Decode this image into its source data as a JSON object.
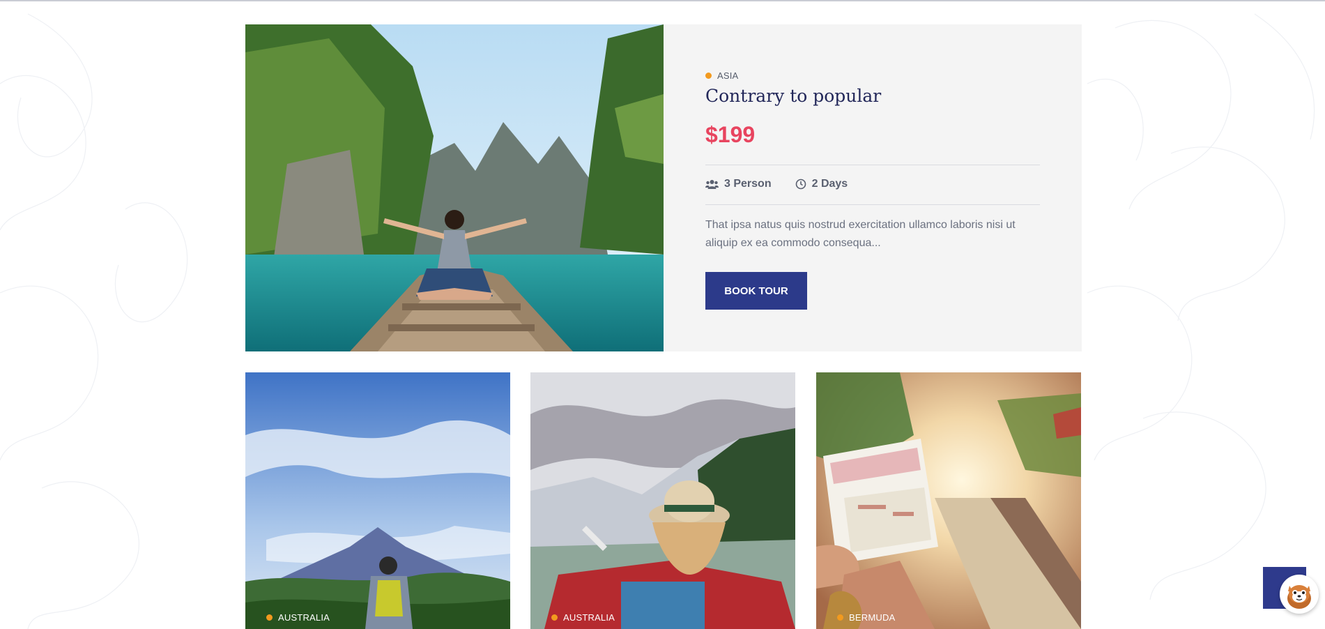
{
  "colors": {
    "accent_orange": "#f29a1f",
    "price_red": "#e8445f",
    "button_blue": "#2c3a8a",
    "title_navy": "#23285a"
  },
  "featured": {
    "region": "ASIA",
    "title": "Contrary to popular",
    "price": "$199",
    "persons": "3 Person",
    "days": "2 Days",
    "description": "That ipsa natus quis nostrud exercitation ullamco laboris nisi ut aliquip ex ea commodo consequa...",
    "button_label": "BOOK TOUR",
    "icons": [
      "users-icon",
      "clock-icon"
    ]
  },
  "cards": [
    {
      "region": "AUSTRALIA"
    },
    {
      "region": "AUSTRALIA"
    },
    {
      "region": "BERMUDA"
    }
  ],
  "widget": {
    "icon": "mascot-chat-icon"
  }
}
